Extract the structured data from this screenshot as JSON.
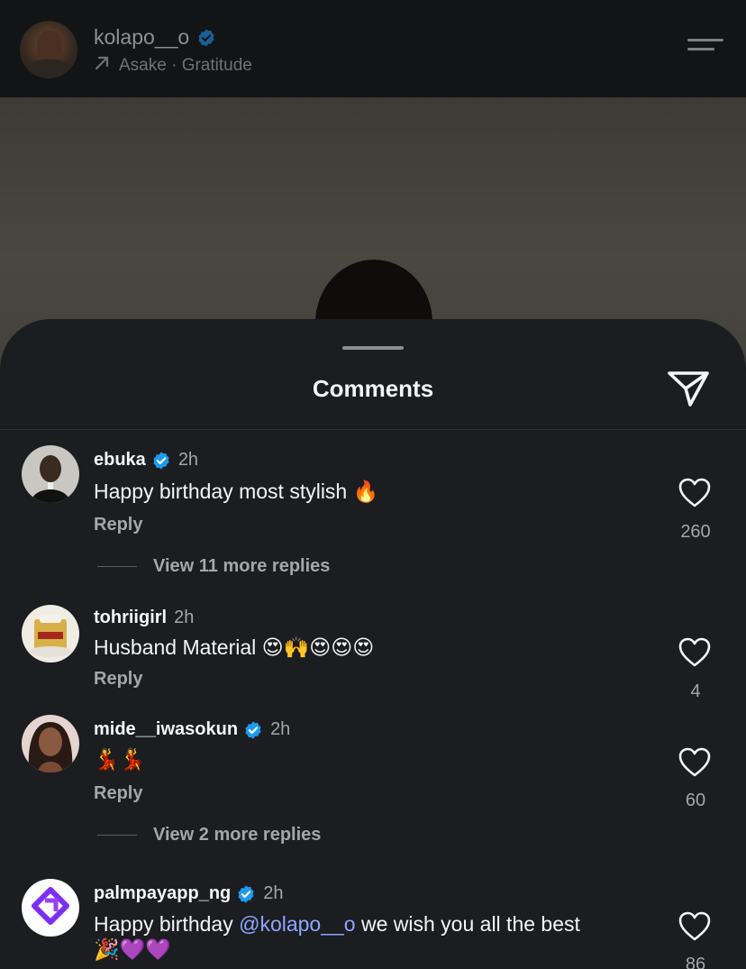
{
  "header": {
    "username": "kolapo__o",
    "music": "Asake · Gratitude"
  },
  "sheet": {
    "title": "Comments"
  },
  "comments": [
    {
      "username": "ebuka",
      "verified": true,
      "time": "2h",
      "text": "Happy birthday most stylish 🔥",
      "reply_label": "Reply",
      "likes": "260",
      "view_more": "View 11 more replies"
    },
    {
      "username": "tohriigirl",
      "verified": false,
      "time": "2h",
      "text": "Husband Material 😍🙌😍😍😍",
      "reply_label": "Reply",
      "likes": "4"
    },
    {
      "username": "mide__iwasokun",
      "verified": true,
      "time": "2h",
      "text": "💃💃",
      "reply_label": "Reply",
      "likes": "60",
      "view_more": "View 2 more replies"
    },
    {
      "username": "palmpayapp_ng",
      "verified": true,
      "time": "2h",
      "text_before": "Happy birthday ",
      "mention": "@kolapo__o",
      "text_after": " we wish you all the best",
      "text_line2": "🎉💜💜",
      "likes": "86"
    }
  ],
  "colors": {
    "sheet_bg": "#1b1d21",
    "verified_blue": "#1d9bf0",
    "mention": "#8fa6ff",
    "muted_text": "#a3a6ab"
  },
  "icons": [
    "verified-badge-icon",
    "arrow-up-right-icon",
    "menu-icon",
    "share-send-icon",
    "heart-icon"
  ]
}
